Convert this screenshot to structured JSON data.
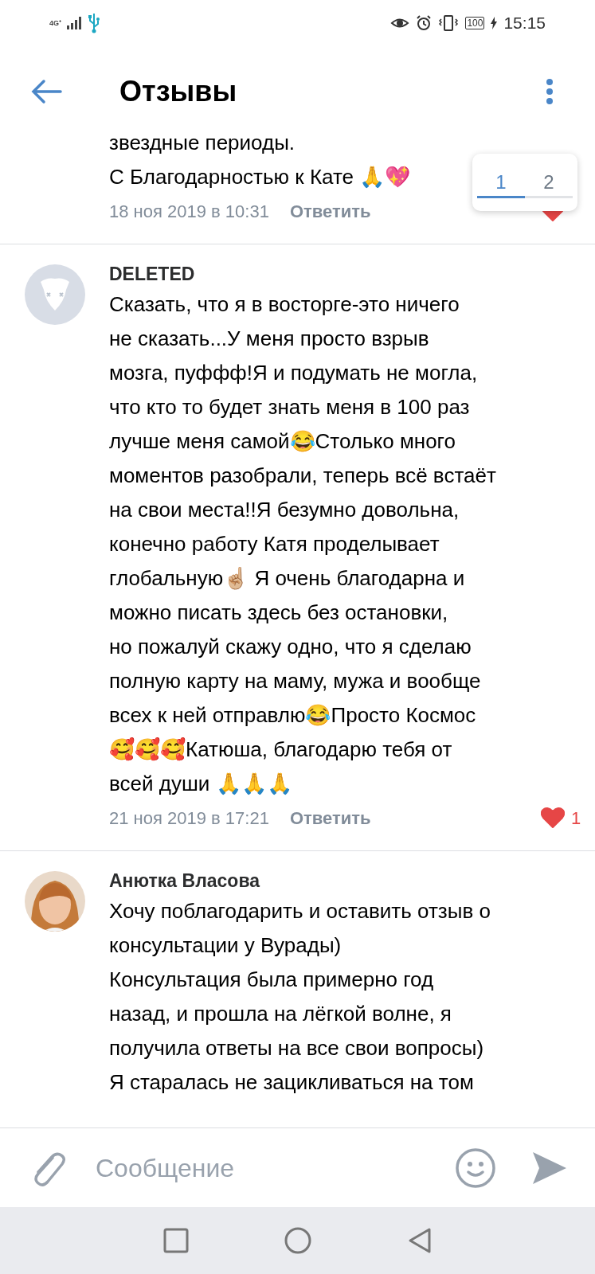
{
  "status_bar": {
    "network": "4G⁺",
    "battery": "100",
    "time": "15:15"
  },
  "header": {
    "title": "Отзывы"
  },
  "pager": [
    {
      "label": "1",
      "selected": true
    },
    {
      "label": "2",
      "selected": false
    }
  ],
  "comments": [
    {
      "kind": "continued",
      "text": "звездные периоды.\nС Благодарностью к Кате 🙏💖",
      "date": "18 ноя 2019 в 10:31",
      "reply": "Ответить",
      "liked": true
    },
    {
      "kind": "deleted",
      "author": "DELETED",
      "text": "Сказать, что я в восторге-это ничего\nне сказать...У меня просто взрыв\nмозга, пуффф!Я и подумать не могла,\nчто кто то будет знать меня в 100 раз\nлучше меня самой😂Столько много\nмоментов разобрали, теперь всё встаёт\nна свои места!!Я безумно довольна,\nконечно работу Катя проделывает\nглобальную☝🏼 Я очень благодарна и\nможно писать здесь без остановки,\nно пожалуй скажу одно, что я сделаю\nполную карту на маму, мужа и вообще\nвсех к ней отправлю😂Просто Космос\n🥰🥰🥰Катюша, благодарю тебя от\nвсей души 🙏🙏🙏",
      "date": "21 ноя 2019 в 17:21",
      "reply": "Ответить",
      "liked": true,
      "likes": "1"
    },
    {
      "author": "Анютка Власова",
      "text": "Хочу поблагодарить и оставить отзыв о\nконсультации у Вурады)\nКонсультация была примерно год\nназад, и прошла на лёгкой волне, я\nполучила ответы на все свои вопросы)\nЯ старалась не зацикливаться на том"
    }
  ],
  "composer": {
    "placeholder": "Сообщение"
  }
}
